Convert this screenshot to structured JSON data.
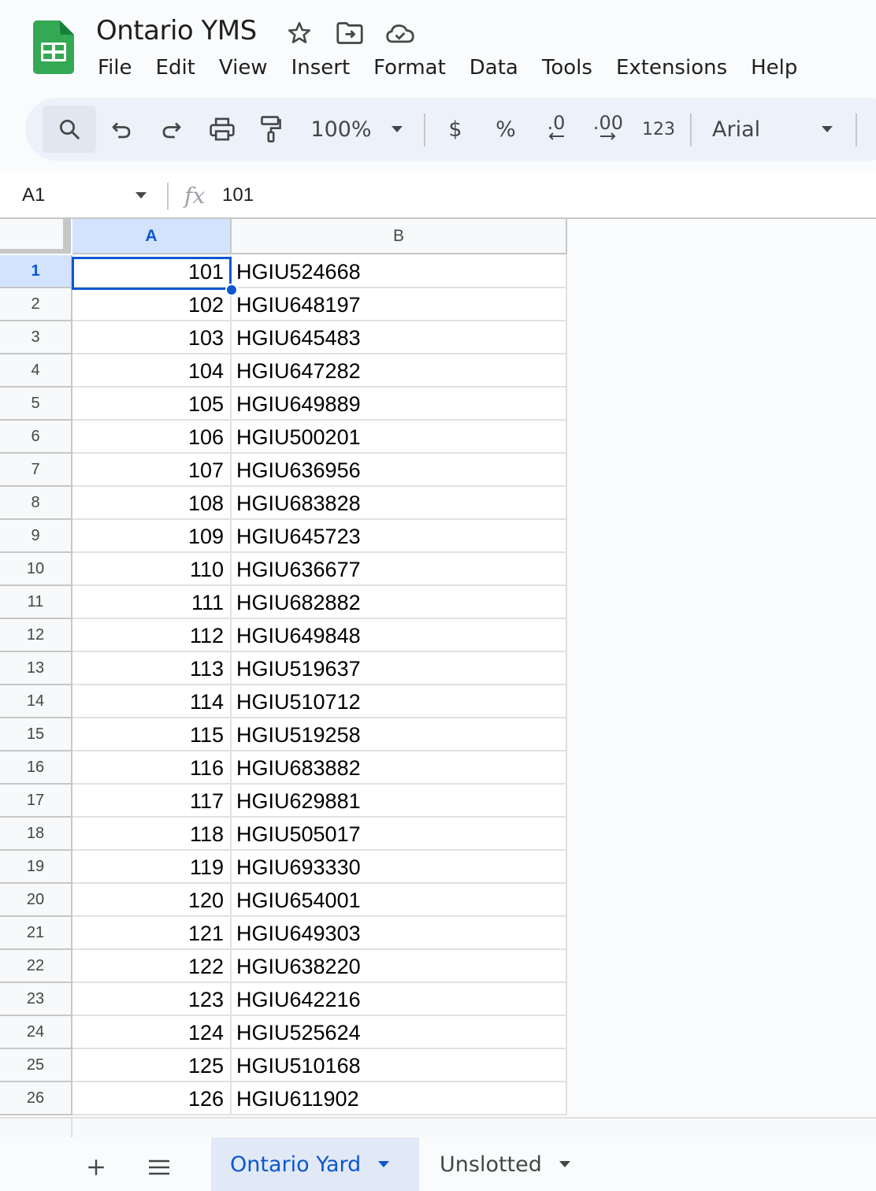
{
  "doc": {
    "title": "Ontario YMS"
  },
  "menu": [
    "File",
    "Edit",
    "View",
    "Insert",
    "Format",
    "Data",
    "Tools",
    "Extensions",
    "Help"
  ],
  "toolbar": {
    "zoom": "100%",
    "currency": "$",
    "percent": "%",
    "decrease_decimal": ".0",
    "increase_decimal": ".00",
    "number_format": "123",
    "font": "Arial",
    "icons": [
      "search-icon",
      "undo-icon",
      "redo-icon",
      "print-icon",
      "paint-format-icon",
      "chevron-down-icon"
    ]
  },
  "formula_bar": {
    "cell_ref": "A1",
    "value": "101"
  },
  "grid": {
    "columns": [
      "A",
      "B"
    ],
    "selected_cell": "A1",
    "rows": [
      {
        "n": "1",
        "a": "101",
        "b": "HGIU524668"
      },
      {
        "n": "2",
        "a": "102",
        "b": "HGIU648197"
      },
      {
        "n": "3",
        "a": "103",
        "b": "HGIU645483"
      },
      {
        "n": "4",
        "a": "104",
        "b": "HGIU647282"
      },
      {
        "n": "5",
        "a": "105",
        "b": "HGIU649889"
      },
      {
        "n": "6",
        "a": "106",
        "b": "HGIU500201"
      },
      {
        "n": "7",
        "a": "107",
        "b": "HGIU636956"
      },
      {
        "n": "8",
        "a": "108",
        "b": "HGIU683828"
      },
      {
        "n": "9",
        "a": "109",
        "b": "HGIU645723"
      },
      {
        "n": "10",
        "a": "110",
        "b": "HGIU636677"
      },
      {
        "n": "11",
        "a": "111",
        "b": "HGIU682882"
      },
      {
        "n": "12",
        "a": "112",
        "b": "HGIU649848"
      },
      {
        "n": "13",
        "a": "113",
        "b": "HGIU519637"
      },
      {
        "n": "14",
        "a": "114",
        "b": "HGIU510712"
      },
      {
        "n": "15",
        "a": "115",
        "b": "HGIU519258"
      },
      {
        "n": "16",
        "a": "116",
        "b": "HGIU683882"
      },
      {
        "n": "17",
        "a": "117",
        "b": "HGIU629881"
      },
      {
        "n": "18",
        "a": "118",
        "b": "HGIU505017"
      },
      {
        "n": "19",
        "a": "119",
        "b": "HGIU693330"
      },
      {
        "n": "20",
        "a": "120",
        "b": "HGIU654001"
      },
      {
        "n": "21",
        "a": "121",
        "b": "HGIU649303"
      },
      {
        "n": "22",
        "a": "122",
        "b": "HGIU638220"
      },
      {
        "n": "23",
        "a": "123",
        "b": "HGIU642216"
      },
      {
        "n": "24",
        "a": "124",
        "b": "HGIU525624"
      },
      {
        "n": "25",
        "a": "125",
        "b": "HGIU510168"
      },
      {
        "n": "26",
        "a": "126",
        "b": "HGIU611902"
      }
    ]
  },
  "sheets": [
    {
      "label": "Ontario Yard",
      "active": true
    },
    {
      "label": "Unslotted",
      "active": false
    }
  ],
  "colors": {
    "accent": "#0b57d0",
    "selection_header": "#d3e3fd",
    "toolbar_bg": "#edf2fa",
    "sheets_green": "#34a853"
  }
}
